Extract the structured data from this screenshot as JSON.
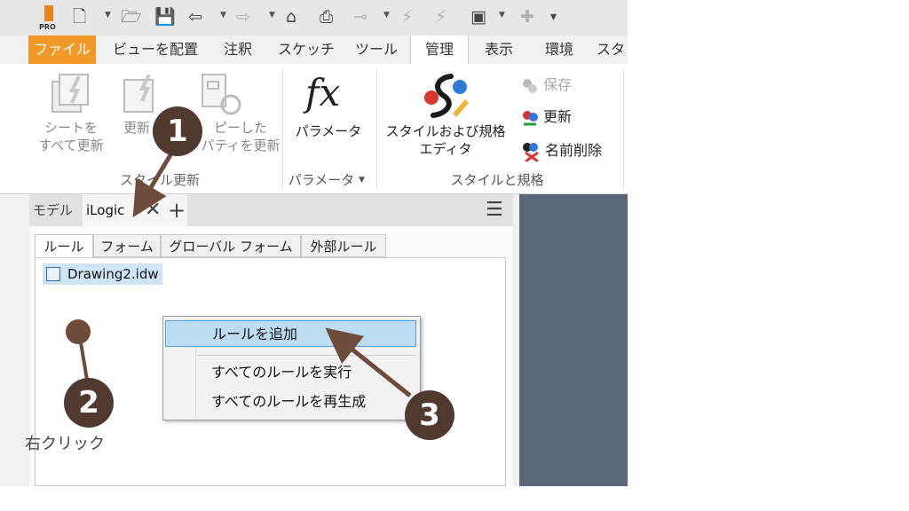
{
  "app": {
    "logo_text": "PRO",
    "tabs": [
      "ファイル",
      "ビューを配置",
      "注釈",
      "スケッチ",
      "ツール",
      "管理",
      "表示",
      "環境",
      "スタ"
    ],
    "active_tab": "管理"
  },
  "ribbon": {
    "style_update": {
      "title": "スタイル更新",
      "btn1": "シートを\nすべて更新",
      "btn2": "更新",
      "btn3": "ピーした\nパティを更新"
    },
    "parameters": {
      "title": "パラメータ",
      "btn": "パラメータ",
      "fx": "fx"
    },
    "styles": {
      "title": "スタイルと規格",
      "editor": "スタイルおよび規格\nエディタ",
      "save": "保存",
      "update": "更新",
      "purge": "名前削除"
    }
  },
  "browser": {
    "tabs": [
      "モデル",
      "iLogic"
    ],
    "active": "iLogic",
    "subtabs": [
      "ルール",
      "フォーム",
      "グローバル フォーム",
      "外部ルール"
    ],
    "tree_item": "Drawing2.idw"
  },
  "context_menu": {
    "items": [
      "ルールを追加",
      "すべてのルールを実行",
      "すべてのルールを再生成"
    ]
  },
  "annotations": {
    "step1": "1",
    "step2": "2",
    "step3": "3",
    "right_click": "右クリック",
    "marker_color": "#503a30"
  }
}
